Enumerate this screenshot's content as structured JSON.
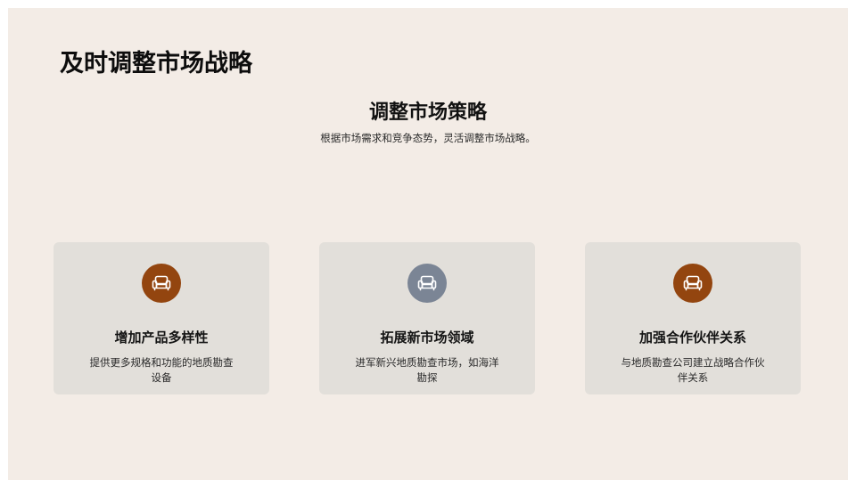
{
  "slide": {
    "title": "及时调整市场战略"
  },
  "section": {
    "title": "调整市场策略",
    "subtitle": "根据市场需求和竞争态势，灵活调整市场战略。"
  },
  "cards": [
    {
      "icon": "sofa-icon",
      "icon_color": "#93450f",
      "title": "增加产品多样性",
      "description": "提供更多规格和功能的地质勘查设备"
    },
    {
      "icon": "sofa-icon",
      "icon_color": "#7b8595",
      "title": "拓展新市场领域",
      "description": "进军新兴地质勘查市场，如海洋勘探"
    },
    {
      "icon": "sofa-icon",
      "icon_color": "#93450f",
      "title": "加强合作伙伴关系",
      "description": "与地质勘查公司建立战略合作伙伴关系"
    }
  ]
}
